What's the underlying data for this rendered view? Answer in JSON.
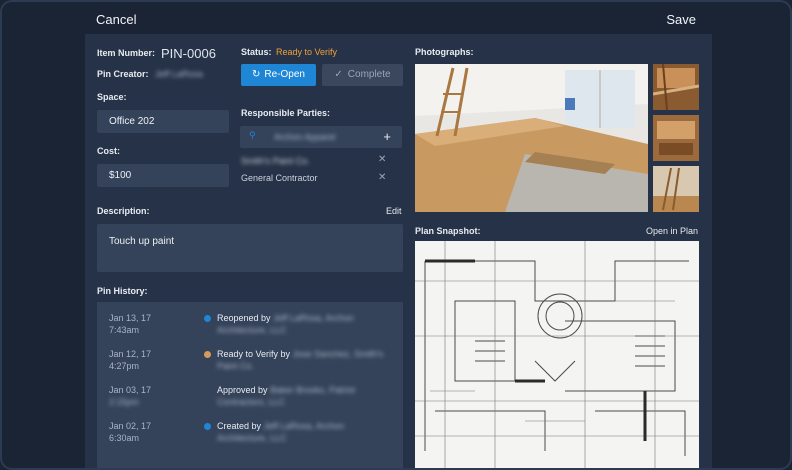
{
  "header": {
    "cancel_label": "Cancel",
    "save_label": "Save"
  },
  "item": {
    "number_label": "Item Number:",
    "number_value": "PIN-0006",
    "creator_label": "Pin Creator:",
    "creator_value": "Jeff LaRosa"
  },
  "space": {
    "label": "Space:",
    "value": "Office 202"
  },
  "cost": {
    "label": "Cost:",
    "value": "$100"
  },
  "status": {
    "label": "Status:",
    "value": "Ready to Verify",
    "color": "#f0a13a"
  },
  "actions": {
    "reopen_label": "Re-Open",
    "complete_label": "Complete"
  },
  "responsible": {
    "label": "Responsible Parties:",
    "search_value": "Archon Apparel",
    "parties": [
      {
        "name": "Smith's Paint Co."
      },
      {
        "name": "General Contractor"
      }
    ]
  },
  "description": {
    "label": "Description:",
    "edit_label": "Edit",
    "value": "Touch up paint"
  },
  "history": {
    "label": "Pin History:",
    "entries": [
      {
        "date": "Jan 13, 17",
        "time": "7:43am",
        "action": "Reopened by",
        "who": "Jeff LaRosa, Archon Architecture, LLC",
        "dot_color": "#1f86d6"
      },
      {
        "date": "Jan 12, 17",
        "time": "4:27pm",
        "action": "Ready to Verify by",
        "who": "Jose Sanchez, Smith's Paint Co.",
        "dot_color": "#d69a5c"
      },
      {
        "date": "Jan 03, 17",
        "time": "2:15pm",
        "action": "Approved by",
        "who": "Baker Brooks, Patriot Contractors, LLC",
        "dot_color": ""
      },
      {
        "date": "Jan 02, 17",
        "time": "6:30am",
        "action": "Created by",
        "who": "Jeff LaRosa, Archon Architecture, LLC",
        "dot_color": "#1f86d6"
      }
    ]
  },
  "photographs": {
    "label": "Photographs:"
  },
  "plan": {
    "label": "Plan Snapshot:",
    "open_label": "Open in Plan"
  },
  "colors": {
    "accent": "#1f86d6",
    "panel": "#263247",
    "field": "#34425a",
    "background": "#1b2434"
  }
}
